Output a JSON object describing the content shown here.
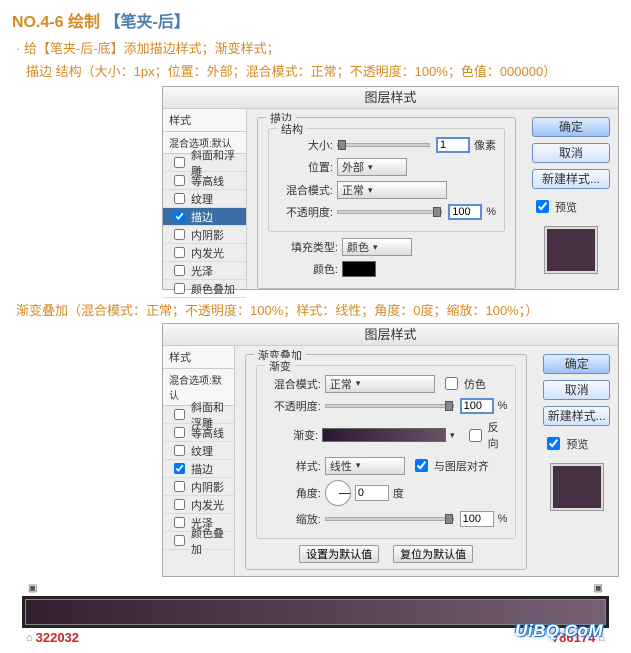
{
  "title": {
    "no": "NO.4-6",
    "verb": "绘制",
    "obj": "【笔夹-后】"
  },
  "line1": "· 给【笔夹-后-底】添加描边样式；渐变样式；",
  "line2": "描边 结构（大小：1px；位置：外部；混合模式：正常；不透明度：100%；色值：000000）",
  "gradient_line": "渐变叠加（混合模式：正常；不透明度：100%；样式：线性；角度：0度；缩放：100%；）",
  "dialog_title": "图层样式",
  "styles_panel": {
    "head": "样式",
    "sub": "混合选项:默认",
    "items": [
      {
        "label": "斜面和浮雕",
        "checked": false
      },
      {
        "label": "等高线",
        "checked": false
      },
      {
        "label": "纹理",
        "checked": false
      },
      {
        "label": "描边",
        "checked": true
      },
      {
        "label": "内阴影",
        "checked": false
      },
      {
        "label": "内发光",
        "checked": false
      },
      {
        "label": "光泽",
        "checked": false
      },
      {
        "label": "颜色叠加",
        "checked": false
      }
    ]
  },
  "stroke_panel": {
    "group": "描边",
    "sub": "结构",
    "size_label": "大小:",
    "size_value": "1",
    "size_unit": "像素",
    "position_label": "位置:",
    "position_value": "外部",
    "blend_label": "混合模式:",
    "blend_value": "正常",
    "opacity_label": "不透明度:",
    "opacity_value": "100",
    "opacity_unit": "%",
    "filltype_label": "填充类型:",
    "filltype_value": "颜色",
    "color_label": "颜色:"
  },
  "gradient_panel": {
    "group": "渐变叠加",
    "sub": "渐变",
    "blend_label": "混合模式:",
    "blend_value": "正常",
    "dither_label": "仿色",
    "dither_checked": false,
    "opacity_label": "不透明度:",
    "opacity_value": "100",
    "opacity_unit": "%",
    "grad_label": "渐变:",
    "reverse_label": "反向",
    "reverse_checked": false,
    "style_label": "样式:",
    "style_value": "线性",
    "align_label": "与图层对齐",
    "align_checked": true,
    "angle_label": "角度:",
    "angle_value": "0",
    "angle_unit": "度",
    "scale_label": "缩放:",
    "scale_value": "100",
    "scale_unit": "%",
    "btn_default": "设置为默认值",
    "btn_reset": "复位为默认值"
  },
  "right_buttons": {
    "ok": "确定",
    "cancel": "取消",
    "new_style": "新建样式...",
    "preview": "预览"
  },
  "gradient_stops": {
    "left": "322032",
    "right": "786174"
  },
  "watermark": "UiBQ.CoM"
}
